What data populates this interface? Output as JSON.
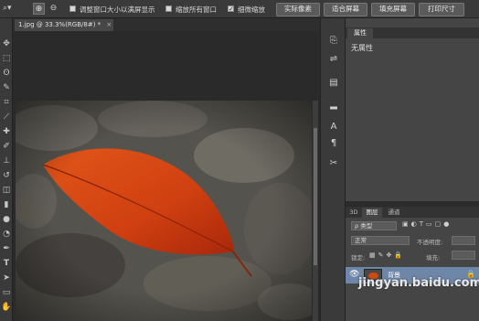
{
  "options_bar": {
    "checkbox_resize_label": "调整窗口大小以满屏显示",
    "checkbox_zoom_all_label": "缩放所有窗口",
    "checkbox_scrubby_label": "细微缩放",
    "actual_pixels_label": "实际像素",
    "fit_screen_label": "适合屏幕",
    "fill_screen_label": "填充屏幕",
    "print_size_label": "打印尺寸",
    "zoom_in_icon": "zoom-in",
    "zoom_out_icon": "zoom-out"
  },
  "document": {
    "tab_title": "1.jpg @ 33.3%(RGB/8#) *",
    "close_glyph": "×"
  },
  "properties_panel": {
    "tab_label": "属性",
    "no_properties_text": "无属性"
  },
  "layers_panel": {
    "tabs": [
      "3D",
      "图层",
      "通道"
    ],
    "filter_type": "ρ 类型",
    "blend_mode": "正常",
    "opacity_label": "不透明度:",
    "lock_label": "锁定:",
    "fill_label": "填充:",
    "layer_name": "背景"
  },
  "watermark": {
    "text": "jingyan.baidu.com"
  },
  "colors": {
    "accent_layer_highlight": "#6e86a8",
    "leaf": "#d24a12"
  }
}
